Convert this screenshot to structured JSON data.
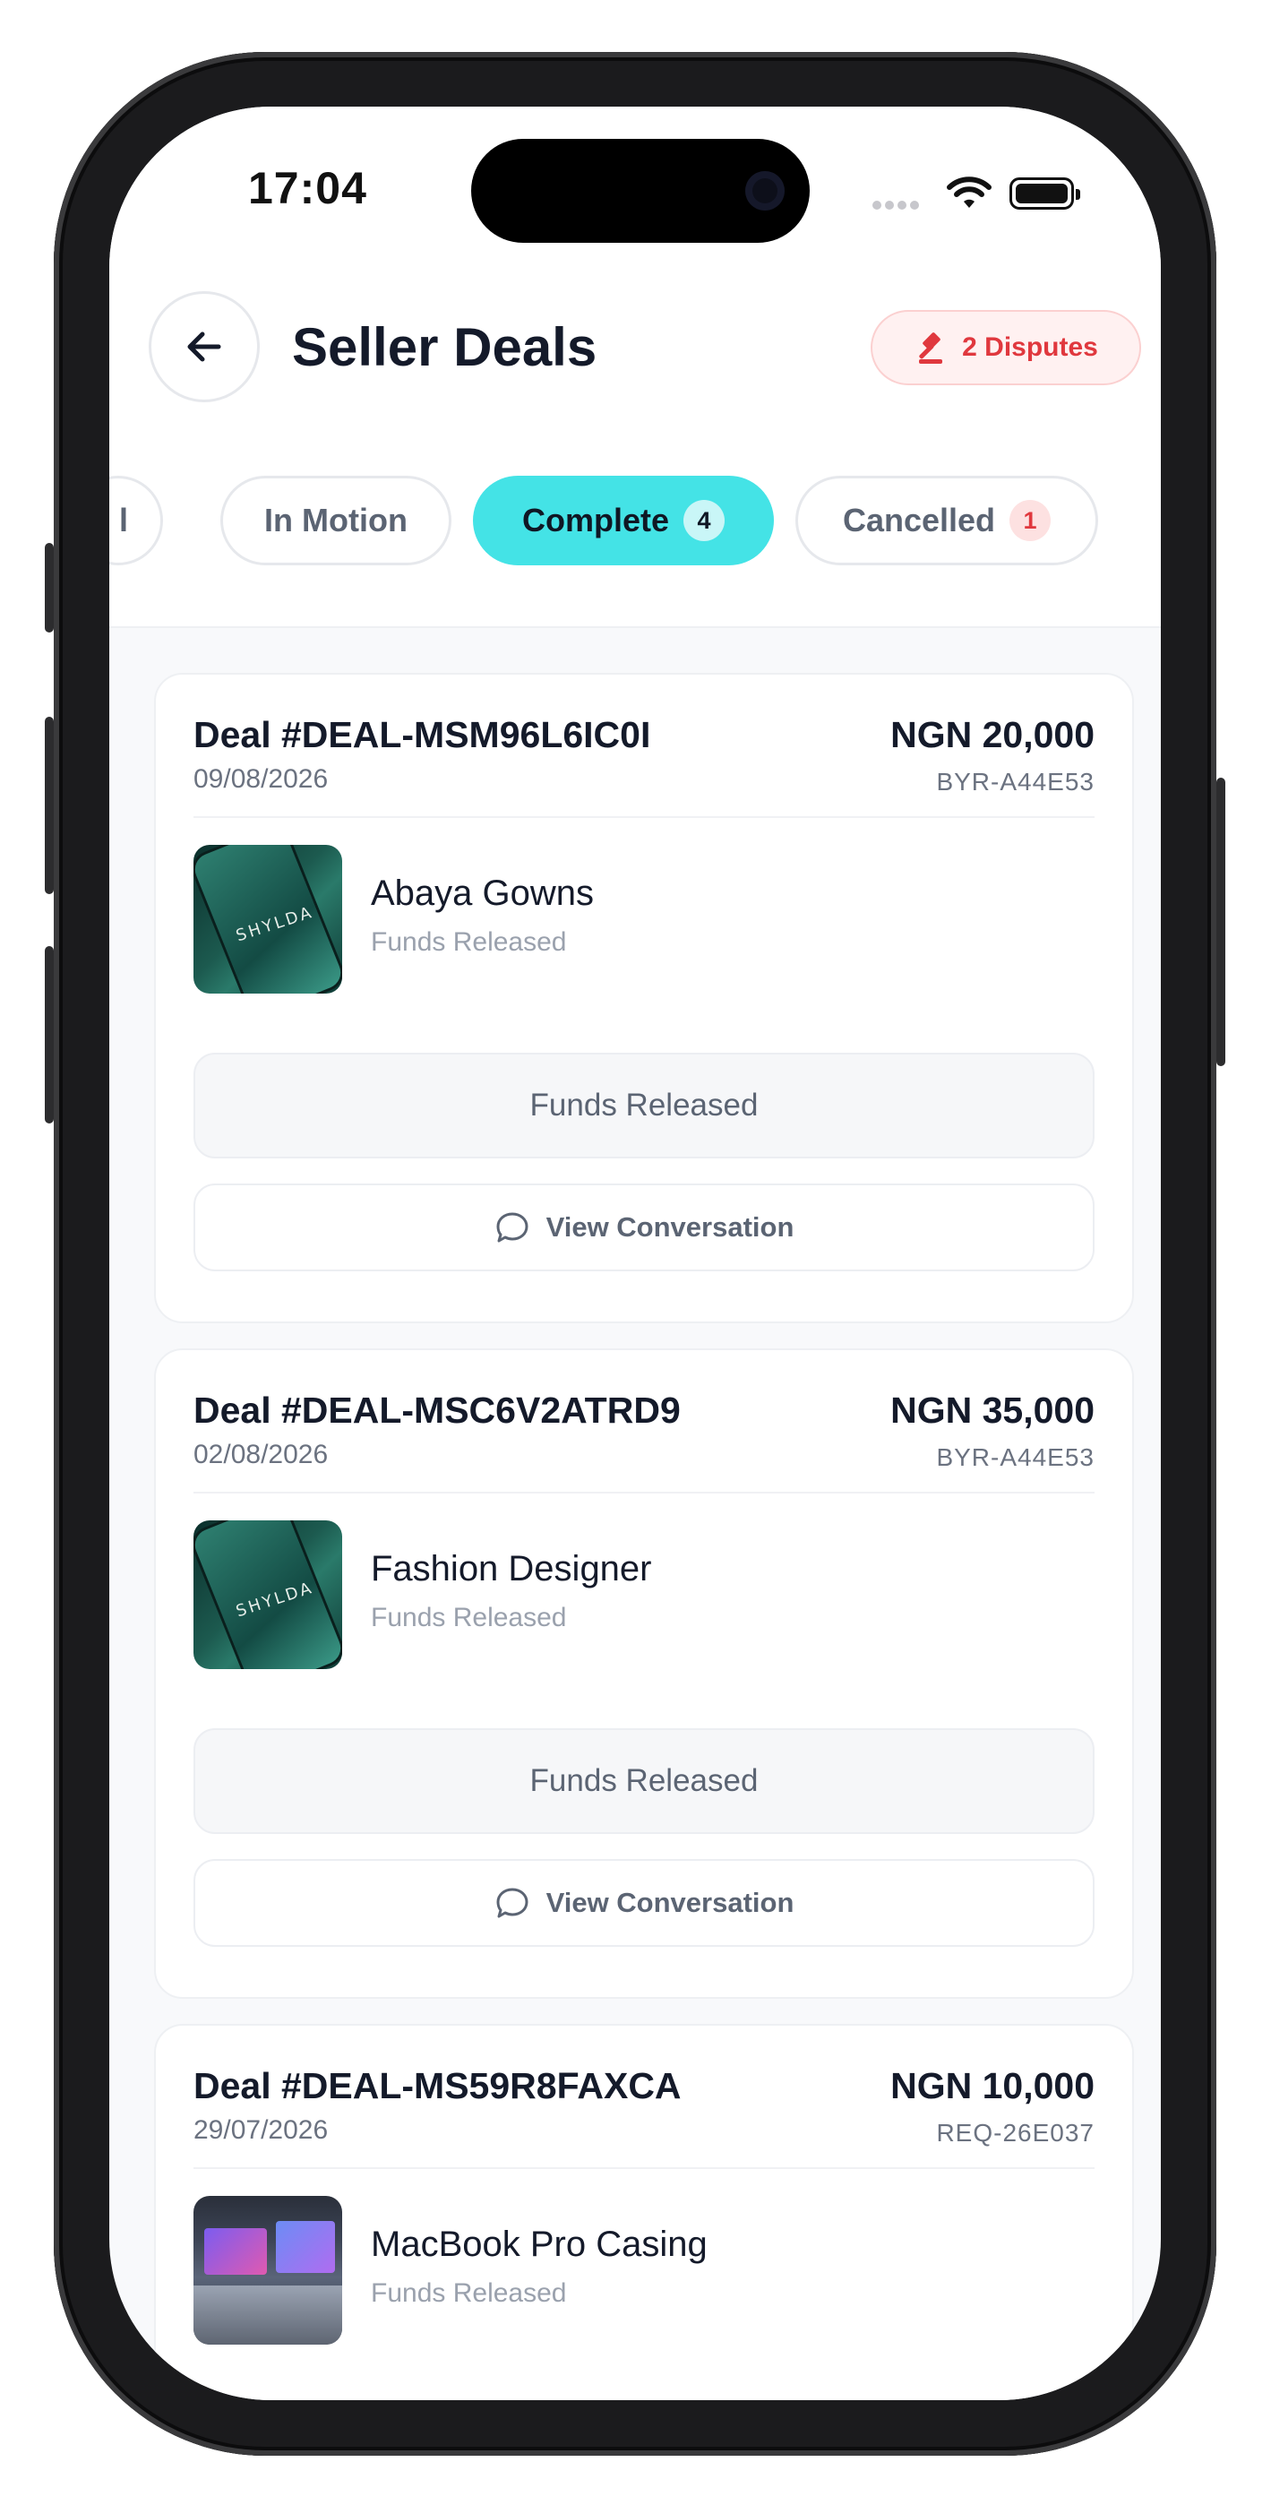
{
  "status_bar": {
    "time": "17:04"
  },
  "header": {
    "title": "Seller Deals",
    "disputes_label": "2 Disputes"
  },
  "tabs": [
    {
      "label": "l",
      "count": null
    },
    {
      "label": "In Motion",
      "count": null
    },
    {
      "label": "Complete",
      "count": "4",
      "active": true
    },
    {
      "label": "Cancelled",
      "count": "1"
    }
  ],
  "deals": [
    {
      "deal_id": "Deal #DEAL-MSM96L6IC0I",
      "date": "09/08/2026",
      "amount": "NGN 20,000",
      "ref": "BYR-A44E53",
      "product": "Abaya Gowns",
      "product_status": "Funds Released",
      "status_label": "Funds Released",
      "conversation_label": "View Conversation",
      "thumb_text": "SHYLDA"
    },
    {
      "deal_id": "Deal #DEAL-MSC6V2ATRD9",
      "date": "02/08/2026",
      "amount": "NGN 35,000",
      "ref": "BYR-A44E53",
      "product": "Fashion Designer",
      "product_status": "Funds Released",
      "status_label": "Funds Released",
      "conversation_label": "View Conversation",
      "thumb_text": "SHYLDA"
    },
    {
      "deal_id": "Deal #DEAL-MS59R8FAXCA",
      "date": "29/07/2026",
      "amount": "NGN 10,000",
      "ref": "REQ-26E037",
      "product": "MacBook Pro Casing",
      "product_status": "Funds Released"
    }
  ],
  "colors": {
    "accent": "#44e3e6",
    "danger": "#e0383e",
    "text": "#141a2a",
    "muted": "#6b7280"
  },
  "icons": [
    "back-arrow-icon",
    "gavel-icon",
    "chat-bubble-icon",
    "wifi-icon",
    "battery-icon"
  ]
}
